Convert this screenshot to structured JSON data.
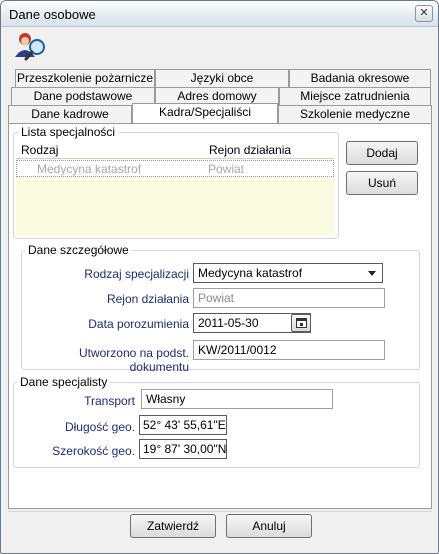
{
  "window": {
    "title": "Dane osobowe"
  },
  "tabs": {
    "row1": [
      "Przeszkolenie pożarnicze",
      "Języki obce",
      "Badania okresowe"
    ],
    "row2": [
      "Dane podstawowe",
      "Adres domowy",
      "Miejsce zatrudnienia"
    ],
    "row3": [
      "Dane kadrowe",
      "Kadra/Specjaliści",
      "Szkolenie medyczne"
    ],
    "active": "Kadra/Specjaliści"
  },
  "list_section": {
    "label": "Lista specjalności",
    "columns": [
      "Rodzaj",
      "Rejon działania"
    ],
    "rows": [
      {
        "rodzaj": "Medycyna katastrof",
        "rejon": "Powiat"
      }
    ],
    "add_button": "Dodaj",
    "remove_button": "Usuń"
  },
  "details": {
    "label": "Dane szczegółowe",
    "rodzaj_label": "Rodzaj specjalizacji",
    "rodzaj_value": "Medycyna katastrof",
    "rejon_label": "Rejon działania",
    "rejon_value": "Powiat",
    "date_label": "Data porozumienia",
    "date_value": "2011-05-30",
    "doc_label": "Utworzono na podst. dokumentu",
    "doc_value": "KW/2011/0012"
  },
  "specialist": {
    "label": "Dane specjalisty",
    "transport_label": "Transport",
    "transport_value": "Własny",
    "lon_label": "Długość geo.",
    "lon_value": "52° 43' 55,61\"E",
    "lat_label": "Szerokość geo.",
    "lat_value": "19° 87' 30,00\"N"
  },
  "footer": {
    "confirm": "Zatwierdź",
    "cancel": "Anuluj"
  },
  "colors": {
    "label_text": "#1f2a78",
    "list_bg": "#fbfbe1",
    "dim_text": "#a8a8a8"
  }
}
